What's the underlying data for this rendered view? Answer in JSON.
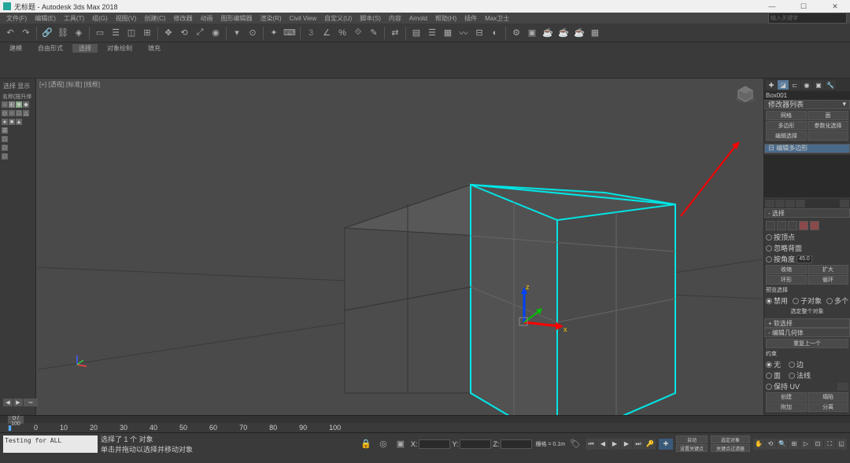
{
  "titlebar": {
    "title": "无标题 - Autodesk 3ds Max 2018"
  },
  "win": {
    "min": "—",
    "max": "☐",
    "close": "✕"
  },
  "menu": [
    "文件(F)",
    "编辑(E)",
    "工具(T)",
    "组(G)",
    "视图(V)",
    "创建(C)",
    "修改器",
    "动画",
    "图形编辑器",
    "渲染(R)",
    "Civil View",
    "自定义(U)",
    "脚本(S)",
    "内容",
    "Arnold",
    "帮助(H)",
    "插件",
    "Max卫士"
  ],
  "tabs": [
    "建模",
    "自由形式",
    "选择",
    "对象绘制",
    "填充"
  ],
  "search": {
    "placeholder": "输入关键字"
  },
  "viewport": {
    "label": "[+] [透视] [标准] [线框]"
  },
  "left": {
    "header": "选择  显示",
    "name_header": "名称(按升序"
  },
  "right": {
    "obj_name": "Box001",
    "modifier_list": "修改器列表",
    "buttons": {
      "b1": "网格",
      "b2": "面",
      "b3": "多边形",
      "b4": "参数化选择",
      "b5": "编辑选择",
      "b6": ""
    },
    "rollout_blue": "日 编辑多边形",
    "rollout_sel": "- 选择",
    "sel_opts": {
      "o1": "按顶点",
      "o2": "忽略背面",
      "o3": "按角度",
      "angle": "45.0"
    },
    "shrink": "收缩",
    "grow": "扩大",
    "ring": "环形",
    "loop": "循环",
    "preview": "预览选择",
    "off": "禁用",
    "sub": "子对象",
    "multi": "多个",
    "sel_status": "选定整个对象",
    "soft": "+ 软选择",
    "edit_poly": "- 编辑几何体",
    "repeat": "重复上一个",
    "constraints": "约束",
    "none": "无",
    "edge": "边",
    "face_n": "面",
    "normal": "法线",
    "preserve": "保持 UV",
    "create_btn": "创建",
    "collapse": "塌陷",
    "attach": "附加",
    "detach": "分离"
  },
  "timeline": {
    "frame": "0 / 100",
    "ticks": [
      "0",
      "10",
      "20",
      "30",
      "40",
      "50",
      "60",
      "70",
      "80",
      "90",
      "100"
    ]
  },
  "status": {
    "script": "Testing for ALL",
    "line1": "选择了 1 个 对象",
    "line2": "单击并拖动以选择并移动对象",
    "x": "X:",
    "y": "Y:",
    "z": "Z:",
    "grid": "栅格 = 0.1m",
    "autokey": "自动",
    "setkey": "设置关键点",
    "keyfilter": "关键点过滤器",
    "selected": "选定对象"
  }
}
